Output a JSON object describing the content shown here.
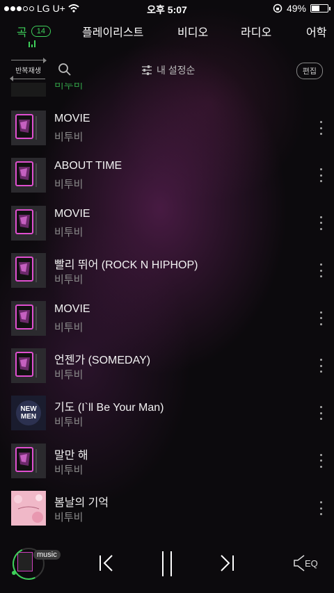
{
  "status_bar": {
    "carrier": "LG U+",
    "time": "오후 5:07",
    "battery": "49%",
    "battery_level": 0.49
  },
  "tabs": [
    {
      "label": "곡",
      "badge": "14",
      "active": true
    },
    {
      "label": "플레이리스트"
    },
    {
      "label": "비디오"
    },
    {
      "label": "라디오"
    },
    {
      "label": "어학"
    }
  ],
  "toolbar": {
    "repeat_label": "반복재생",
    "sort_label": "내 설정순",
    "edit_label": "편집"
  },
  "partial_row": {
    "artist": "비투비"
  },
  "songs": [
    {
      "title": "MOVIE",
      "artist": "비투비",
      "art": "movie"
    },
    {
      "title": "ABOUT TIME",
      "artist": "비투비",
      "art": "movie"
    },
    {
      "title": "MOVIE",
      "artist": "비투비",
      "art": "movie"
    },
    {
      "title": "빨리 뛰어 (ROCK N HIPHOP)",
      "artist": "비투비",
      "art": "movie"
    },
    {
      "title": "MOVIE",
      "artist": "비투비",
      "art": "movie"
    },
    {
      "title": "언젠가 (SOMEDAY)",
      "artist": "비투비",
      "art": "movie"
    },
    {
      "title": "기도 (I`ll Be Your Man)",
      "artist": "비투비",
      "art": "newmen"
    },
    {
      "title": "말만 해",
      "artist": "비투비",
      "art": "movie"
    },
    {
      "title": "봄날의 기억",
      "artist": "비투비",
      "art": "pink"
    }
  ],
  "player": {
    "music_tag": "music",
    "eq_label": "EQ"
  },
  "colors": {
    "accent": "#3ed05a",
    "background": "#0c0a0d"
  }
}
